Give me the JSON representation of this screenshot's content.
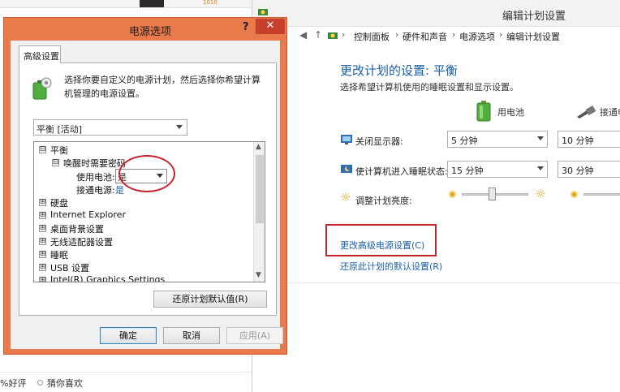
{
  "background_page": {
    "top_orange_text": "1010",
    "rating_text": "%好评",
    "guess_text": "猜你喜欢"
  },
  "control_panel": {
    "window_title": "编辑计划设置",
    "breadcrumb": [
      "控制面板",
      "硬件和声音",
      "电源选项",
      "编辑计划设置"
    ],
    "heading": "更改计划的设置: 平衡",
    "subtitle": "选择希望计算机使用的睡眠设置和显示设置。",
    "col_battery": "用电池",
    "col_ac": "接通电",
    "rows": [
      {
        "label": "关闭显示器:",
        "battery": "5 分钟",
        "ac": "10 分钟"
      },
      {
        "label": "使计算机进入睡眠状态:",
        "battery": "15 分钟",
        "ac": "30 分钟"
      },
      {
        "label": "调整计划亮度:"
      }
    ],
    "link_advanced": "更改高级电源设置(C)",
    "link_restore": "还原此计划的默认设置(R)",
    "accent": "#1a5fa8",
    "highlight_color": "#c8232d"
  },
  "dialog": {
    "title": "电源选项",
    "help": "?",
    "close": "✕",
    "tab": "高级设置",
    "intro": "选择你要自定义的电源计划，然后选择你希望计算机管理的电源设置。",
    "plan": "平衡 [活动]",
    "tree": {
      "root": "平衡",
      "root_toggle": "⊟",
      "child": "唤醒时需要密码",
      "child_toggle": "⊟",
      "battery_label": "使用电池:",
      "battery_value": "是",
      "ac_label": "接通电源:",
      "ac_value": "是",
      "items": [
        "硬盘",
        "Internet Explorer",
        "桌面背景设置",
        "无线适配器设置",
        "睡眠",
        "USB 设置",
        "Intel(R) Graphics Settings"
      ],
      "item_toggle": "⊞"
    },
    "restore_button": "还原计划默认值(R)",
    "ok_button": "确定",
    "cancel_button": "取消",
    "apply_button": "应用(A)",
    "frame_color": "#e97a4c"
  }
}
